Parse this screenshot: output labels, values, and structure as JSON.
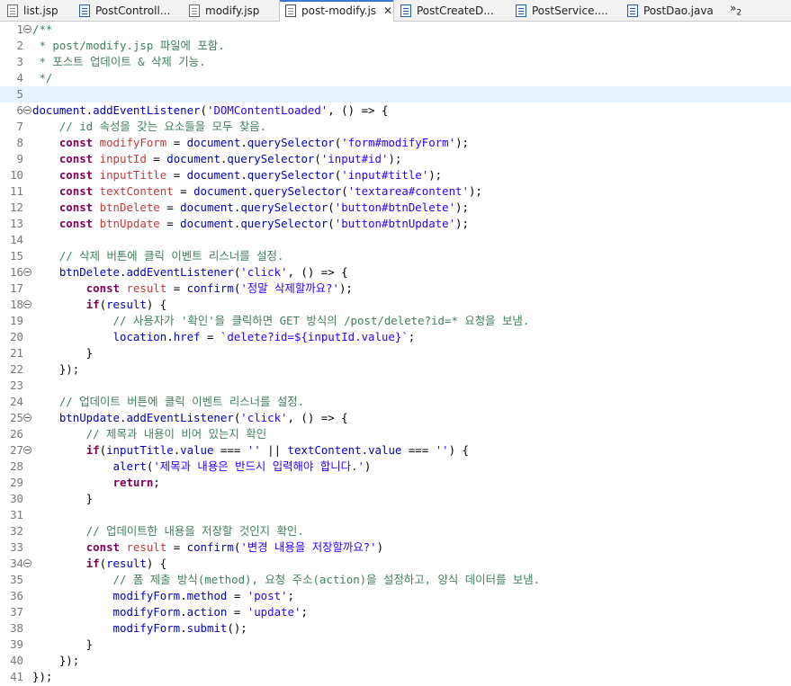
{
  "tabs": [
    {
      "label": "list.jsp",
      "type": "jsp"
    },
    {
      "label": "PostControll...",
      "type": "java"
    },
    {
      "label": "modify.jsp",
      "type": "jsp"
    },
    {
      "label": "post-modify.js",
      "type": "js",
      "active": true
    },
    {
      "label": "PostCreateD...",
      "type": "java"
    },
    {
      "label": "PostService....",
      "type": "java"
    },
    {
      "label": "PostDao.java",
      "type": "java"
    }
  ],
  "overflow_label": "»",
  "overflow_count": "2",
  "close_glyph": "✕",
  "current_line": 5,
  "lines": [
    {
      "n": "1",
      "fold": true,
      "tokens": [
        [
          "cm",
          "/**"
        ]
      ]
    },
    {
      "n": "2",
      "tokens": [
        [
          "cm",
          " * post/modify.jsp 파일에 포함."
        ]
      ]
    },
    {
      "n": "3",
      "tokens": [
        [
          "cm",
          " * 포스트 업데이트 & 삭제 기능."
        ]
      ]
    },
    {
      "n": "4",
      "tokens": [
        [
          "cm",
          " */"
        ]
      ]
    },
    {
      "n": "5",
      "tokens": []
    },
    {
      "n": "6",
      "fold": true,
      "tokens": [
        [
          "ident",
          "document"
        ],
        [
          "plain",
          "."
        ],
        [
          "ident",
          "addEventListener"
        ],
        [
          "plain",
          "("
        ],
        [
          "str",
          "'DOMContentLoaded'"
        ],
        [
          "plain",
          ", () => {"
        ]
      ]
    },
    {
      "n": "7",
      "tokens": [
        [
          "cm",
          "    // id 속성을 갖는 요소들을 모두 찾음."
        ]
      ]
    },
    {
      "n": "8",
      "tokens": [
        [
          "plain",
          "    "
        ],
        [
          "kw",
          "const"
        ],
        [
          "plain",
          " "
        ],
        [
          "var",
          "modifyForm"
        ],
        [
          "plain",
          " = "
        ],
        [
          "ident",
          "document"
        ],
        [
          "plain",
          "."
        ],
        [
          "ident",
          "querySelector"
        ],
        [
          "plain",
          "("
        ],
        [
          "str",
          "'form#modifyForm'"
        ],
        [
          "plain",
          ");"
        ]
      ]
    },
    {
      "n": "9",
      "tokens": [
        [
          "plain",
          "    "
        ],
        [
          "kw",
          "const"
        ],
        [
          "plain",
          " "
        ],
        [
          "var",
          "inputId"
        ],
        [
          "plain",
          " = "
        ],
        [
          "ident",
          "document"
        ],
        [
          "plain",
          "."
        ],
        [
          "ident",
          "querySelector"
        ],
        [
          "plain",
          "("
        ],
        [
          "str",
          "'input#id'"
        ],
        [
          "plain",
          ");"
        ]
      ]
    },
    {
      "n": "10",
      "tokens": [
        [
          "plain",
          "    "
        ],
        [
          "kw",
          "const"
        ],
        [
          "plain",
          " "
        ],
        [
          "var",
          "inputTitle"
        ],
        [
          "plain",
          " = "
        ],
        [
          "ident",
          "document"
        ],
        [
          "plain",
          "."
        ],
        [
          "ident",
          "querySelector"
        ],
        [
          "plain",
          "("
        ],
        [
          "str",
          "'input#title'"
        ],
        [
          "plain",
          ");"
        ]
      ]
    },
    {
      "n": "11",
      "tokens": [
        [
          "plain",
          "    "
        ],
        [
          "kw",
          "const"
        ],
        [
          "plain",
          " "
        ],
        [
          "var",
          "textContent"
        ],
        [
          "plain",
          " = "
        ],
        [
          "ident",
          "document"
        ],
        [
          "plain",
          "."
        ],
        [
          "ident",
          "querySelector"
        ],
        [
          "plain",
          "("
        ],
        [
          "str",
          "'textarea#content'"
        ],
        [
          "plain",
          ");"
        ]
      ]
    },
    {
      "n": "12",
      "tokens": [
        [
          "plain",
          "    "
        ],
        [
          "kw",
          "const"
        ],
        [
          "plain",
          " "
        ],
        [
          "var",
          "btnDelete"
        ],
        [
          "plain",
          " = "
        ],
        [
          "ident",
          "document"
        ],
        [
          "plain",
          "."
        ],
        [
          "ident",
          "querySelector"
        ],
        [
          "plain",
          "("
        ],
        [
          "str",
          "'button#btnDelete'"
        ],
        [
          "plain",
          ");"
        ]
      ]
    },
    {
      "n": "13",
      "tokens": [
        [
          "plain",
          "    "
        ],
        [
          "kw",
          "const"
        ],
        [
          "plain",
          " "
        ],
        [
          "var",
          "btnUpdate"
        ],
        [
          "plain",
          " = "
        ],
        [
          "ident",
          "document"
        ],
        [
          "plain",
          "."
        ],
        [
          "ident",
          "querySelector"
        ],
        [
          "plain",
          "("
        ],
        [
          "str",
          "'button#btnUpdate'"
        ],
        [
          "plain",
          ");"
        ]
      ]
    },
    {
      "n": "14",
      "tokens": []
    },
    {
      "n": "15",
      "tokens": [
        [
          "cm",
          "    // 삭제 버튼에 클릭 이벤트 리스너를 설정."
        ]
      ]
    },
    {
      "n": "16",
      "fold": true,
      "tokens": [
        [
          "plain",
          "    "
        ],
        [
          "ident",
          "btnDelete"
        ],
        [
          "plain",
          "."
        ],
        [
          "ident",
          "addEventListener"
        ],
        [
          "plain",
          "("
        ],
        [
          "str",
          "'click'"
        ],
        [
          "plain",
          ", () => {"
        ]
      ]
    },
    {
      "n": "17",
      "tokens": [
        [
          "plain",
          "        "
        ],
        [
          "kw",
          "const"
        ],
        [
          "plain",
          " "
        ],
        [
          "var",
          "result"
        ],
        [
          "plain",
          " = "
        ],
        [
          "ident",
          "confirm"
        ],
        [
          "plain",
          "("
        ],
        [
          "str",
          "'정말 삭제할까요?'"
        ],
        [
          "plain",
          ");"
        ]
      ]
    },
    {
      "n": "18",
      "fold": true,
      "tokens": [
        [
          "plain",
          "        "
        ],
        [
          "kw",
          "if"
        ],
        [
          "plain",
          "("
        ],
        [
          "ident",
          "result"
        ],
        [
          "plain",
          ") {"
        ]
      ]
    },
    {
      "n": "19",
      "tokens": [
        [
          "cm",
          "            // 사용자가 '확인'을 클릭하면 GET 방식의 /post/delete?id=* 요청을 보냄."
        ]
      ]
    },
    {
      "n": "20",
      "tokens": [
        [
          "plain",
          "            "
        ],
        [
          "ident",
          "location"
        ],
        [
          "plain",
          "."
        ],
        [
          "ident",
          "href"
        ],
        [
          "plain",
          " = "
        ],
        [
          "str",
          "`delete?id=${inputId.value}`"
        ],
        [
          "plain",
          ";"
        ]
      ]
    },
    {
      "n": "21",
      "tokens": [
        [
          "plain",
          "        }"
        ]
      ]
    },
    {
      "n": "22",
      "tokens": [
        [
          "plain",
          "    });"
        ]
      ]
    },
    {
      "n": "23",
      "tokens": []
    },
    {
      "n": "24",
      "tokens": [
        [
          "cm",
          "    // 업데이트 버튼에 클릭 이벤트 리스너를 설정."
        ]
      ]
    },
    {
      "n": "25",
      "fold": true,
      "tokens": [
        [
          "plain",
          "    "
        ],
        [
          "ident",
          "btnUpdate"
        ],
        [
          "plain",
          "."
        ],
        [
          "ident",
          "addEventListener"
        ],
        [
          "plain",
          "("
        ],
        [
          "str",
          "'click'"
        ],
        [
          "plain",
          ", () => {"
        ]
      ]
    },
    {
      "n": "26",
      "tokens": [
        [
          "cm",
          "        // 제목과 내용이 비어 있는지 확인"
        ]
      ]
    },
    {
      "n": "27",
      "fold": true,
      "tokens": [
        [
          "plain",
          "        "
        ],
        [
          "kw",
          "if"
        ],
        [
          "plain",
          "("
        ],
        [
          "ident",
          "inputTitle"
        ],
        [
          "plain",
          "."
        ],
        [
          "ident",
          "value"
        ],
        [
          "plain",
          " === "
        ],
        [
          "str",
          "''"
        ],
        [
          "plain",
          " || "
        ],
        [
          "ident",
          "textContent"
        ],
        [
          "plain",
          "."
        ],
        [
          "ident",
          "value"
        ],
        [
          "plain",
          " === "
        ],
        [
          "str",
          "''"
        ],
        [
          "plain",
          ") {"
        ]
      ]
    },
    {
      "n": "28",
      "tokens": [
        [
          "plain",
          "            "
        ],
        [
          "ident",
          "alert"
        ],
        [
          "plain",
          "("
        ],
        [
          "str",
          "'제목과 내용은 반드시 입력해야 합니다.'"
        ],
        [
          "plain",
          ")"
        ]
      ]
    },
    {
      "n": "29",
      "tokens": [
        [
          "plain",
          "            "
        ],
        [
          "kw",
          "return"
        ],
        [
          "plain",
          ";"
        ]
      ]
    },
    {
      "n": "30",
      "tokens": [
        [
          "plain",
          "        }"
        ]
      ]
    },
    {
      "n": "31",
      "tokens": []
    },
    {
      "n": "32",
      "tokens": [
        [
          "cm",
          "        // 업데이트한 내용을 저장할 것인지 확인."
        ]
      ]
    },
    {
      "n": "33",
      "tokens": [
        [
          "plain",
          "        "
        ],
        [
          "kw",
          "const"
        ],
        [
          "plain",
          " "
        ],
        [
          "var",
          "result"
        ],
        [
          "plain",
          " = "
        ],
        [
          "ident",
          "confirm"
        ],
        [
          "plain",
          "("
        ],
        [
          "str",
          "'변경 내용을 저장할까요?'"
        ],
        [
          "plain",
          ")"
        ]
      ]
    },
    {
      "n": "34",
      "fold": true,
      "tokens": [
        [
          "plain",
          "        "
        ],
        [
          "kw",
          "if"
        ],
        [
          "plain",
          "("
        ],
        [
          "ident",
          "result"
        ],
        [
          "plain",
          ") {"
        ]
      ]
    },
    {
      "n": "35",
      "tokens": [
        [
          "cm",
          "            // 폼 제출 방식(method), 요청 주소(action)을 설정하고, 양식 데이터를 보냄."
        ]
      ]
    },
    {
      "n": "36",
      "tokens": [
        [
          "plain",
          "            "
        ],
        [
          "ident",
          "modifyForm"
        ],
        [
          "plain",
          "."
        ],
        [
          "ident",
          "method"
        ],
        [
          "plain",
          " = "
        ],
        [
          "str",
          "'post'"
        ],
        [
          "plain",
          ";"
        ]
      ]
    },
    {
      "n": "37",
      "tokens": [
        [
          "plain",
          "            "
        ],
        [
          "ident",
          "modifyForm"
        ],
        [
          "plain",
          "."
        ],
        [
          "ident",
          "action"
        ],
        [
          "plain",
          " = "
        ],
        [
          "str",
          "'update'"
        ],
        [
          "plain",
          ";"
        ]
      ]
    },
    {
      "n": "38",
      "tokens": [
        [
          "plain",
          "            "
        ],
        [
          "ident",
          "modifyForm"
        ],
        [
          "plain",
          "."
        ],
        [
          "ident",
          "submit"
        ],
        [
          "plain",
          "();"
        ]
      ]
    },
    {
      "n": "39",
      "tokens": [
        [
          "plain",
          "        }"
        ]
      ]
    },
    {
      "n": "40",
      "tokens": [
        [
          "plain",
          "    });"
        ]
      ]
    },
    {
      "n": "41",
      "tokens": [
        [
          "plain",
          "});"
        ]
      ]
    }
  ]
}
